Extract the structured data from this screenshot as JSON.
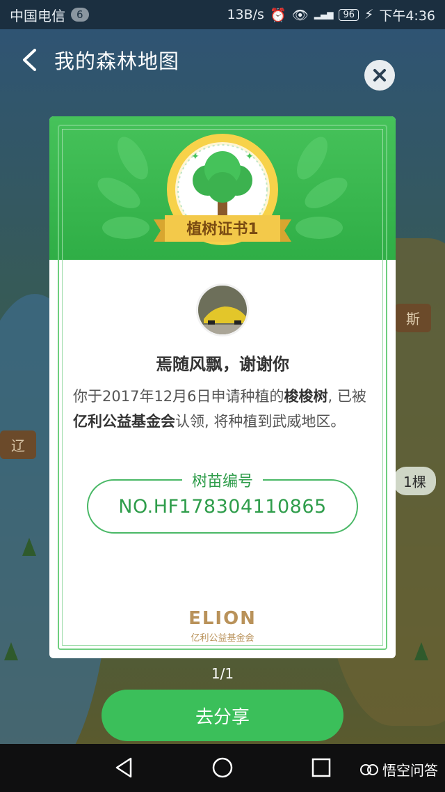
{
  "status_bar": {
    "carrier": "中国电信",
    "carrier_badge": "6",
    "speed": "13B/s",
    "battery": "96",
    "time": "下午4:36"
  },
  "nav": {
    "title": "我的森林地图"
  },
  "map_background": {
    "sign_left": "辽",
    "sign_right": "斯",
    "count_pill": "1棵"
  },
  "certificate": {
    "ribbon_title": "植树证书1",
    "username": "焉随风飘，谢谢你",
    "desc_prefix": "你于2017年12月6日申请种植的",
    "tree_name": "梭梭树",
    "desc_mid": ", 已被",
    "foundation": "亿利公益基金会",
    "desc_suffix": "认领, 将种植到武威地区。",
    "code_label": "树苗编号",
    "code_value": "NO.HF178304110865",
    "logo_brand": "ELION",
    "logo_sub": "亿利公益基金会"
  },
  "pager": "1/1",
  "share_button": "去分享",
  "watermark": "悟空问答",
  "colors": {
    "accent_green": "#3bbf5a",
    "header_green": "#46c25a",
    "code_green": "#2f9d4b",
    "gold": "#b9925a"
  }
}
